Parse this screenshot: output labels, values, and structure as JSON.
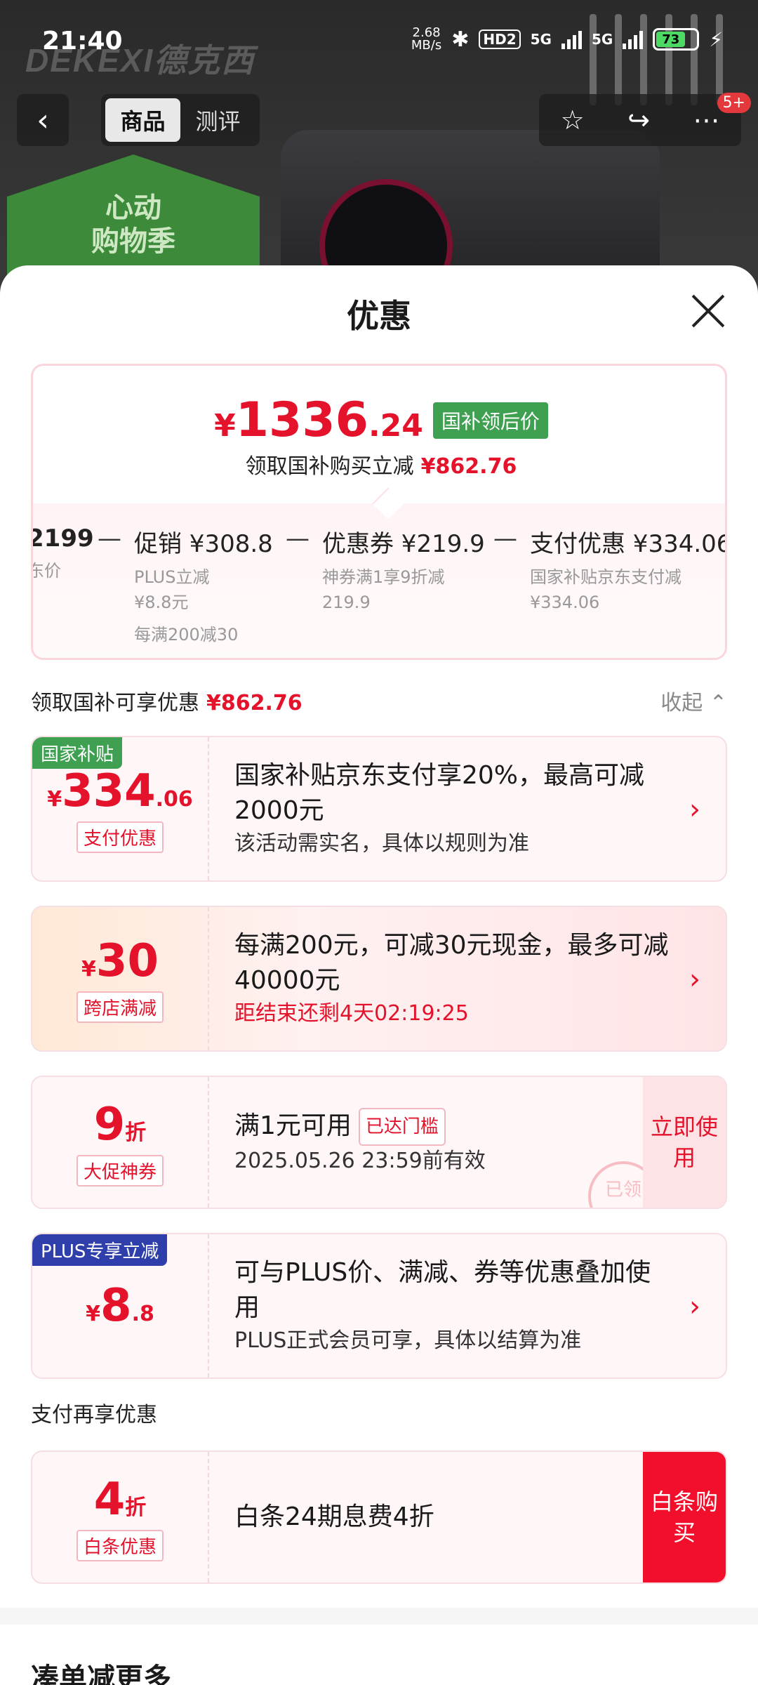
{
  "status_bar": {
    "time": "21:40",
    "net_speed_value": "2.68",
    "net_speed_unit": "MB/s",
    "hd_label": "HD2",
    "signal1": "5G",
    "signal2": "5G",
    "battery": "73"
  },
  "background": {
    "brand": "DEKEXI德克西",
    "promo_line1": "心动",
    "promo_line2": "购物季"
  },
  "top_nav": {
    "back_icon": "chevron-left-icon",
    "tabs": [
      "商品",
      "测评"
    ],
    "active_tab": "商品",
    "notify_count": "5+"
  },
  "sheet": {
    "title": "优惠",
    "final_price": {
      "currency": "¥",
      "integer": "1336",
      "decimal": ".24",
      "tag": "国补领后价"
    },
    "saving_text": "领取国补购买立减",
    "saving_amount": "¥862.76",
    "breakdown": [
      {
        "title": "2199",
        "lines": [
          "东价"
        ]
      },
      {
        "title": "促销 ¥308.8",
        "lines": [
          "PLUS立减",
          "¥8.8元",
          "每满200减30"
        ]
      },
      {
        "title": "优惠券 ¥219.9",
        "lines": [
          "神券满1享9折减",
          "219.9"
        ]
      },
      {
        "title": "支付优惠 ¥334.06",
        "lines": [
          "国家补贴京东支付减",
          "¥334.06"
        ]
      }
    ],
    "minus_sign": "—",
    "section_label": "领取国补可享优惠",
    "section_amount": "¥862.76",
    "collapse_label": "收起"
  },
  "offers": [
    {
      "corner": "国家补贴",
      "currency": "¥",
      "integer": "334",
      "decimal": ".06",
      "tag": "支付优惠",
      "title": "国家补贴京东支付享20%，最高可减2000元",
      "note": "该活动需实名，具体以规则为准"
    },
    {
      "currency": "¥",
      "integer": "30",
      "tag": "跨店满减",
      "title": "每满200元，可减30元现金，最多可减40000元",
      "note": "距结束还剩4天02:19:25"
    },
    {
      "integer": "9",
      "unit": "折",
      "tag": "大促神券",
      "title": "满1元可用",
      "chip": "已达门槛",
      "note": "2025.05.26 23:59前有效",
      "action": "立即使用",
      "stamp": "已领"
    },
    {
      "corner": "PLUS专享立减",
      "currency": "¥",
      "integer": "8",
      "decimal": ".8",
      "tag": "",
      "title": "可与PLUS价、满减、券等优惠叠加使用",
      "note": "PLUS正式会员可享，具体以结算为准"
    }
  ],
  "pay_section_label": "支付再享优惠",
  "pay_offer": {
    "integer": "4",
    "unit": "折",
    "tag": "白条优惠",
    "title": "白条24期息费4折",
    "action": "白条购买"
  },
  "more_title": "凑单减更多",
  "colors": {
    "accent": "#e4122b",
    "gov_green": "#3ea050",
    "plus_blue": "#2e3eaa"
  }
}
